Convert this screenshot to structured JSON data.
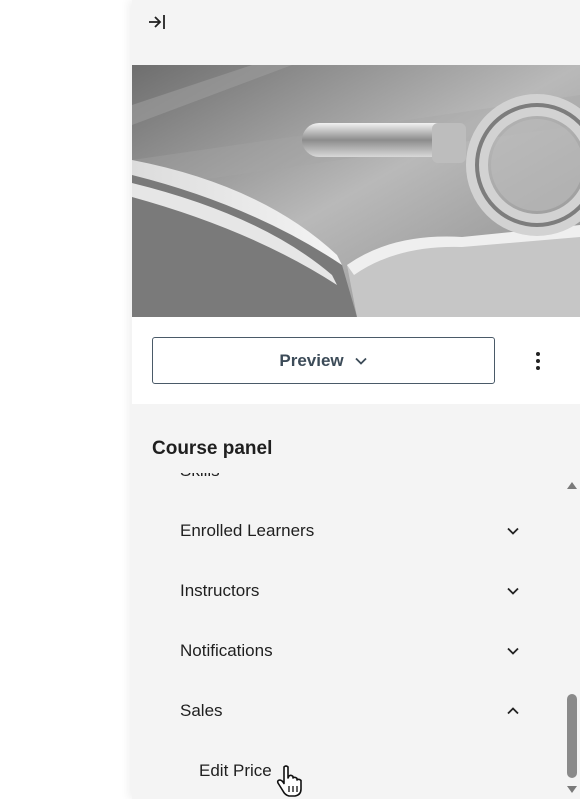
{
  "action_bar": {
    "preview_label": "Preview"
  },
  "course_panel": {
    "title": "Course panel",
    "items": [
      {
        "label": "Skills",
        "icon": "chevron-down-icon"
      },
      {
        "label": "Enrolled Learners",
        "icon": "chevron-down-icon"
      },
      {
        "label": "Instructors",
        "icon": "chevron-down-icon"
      },
      {
        "label": "Notifications",
        "icon": "chevron-down-icon"
      },
      {
        "label": "Sales",
        "icon": "chevron-up-icon",
        "expanded": true
      }
    ],
    "sales_subitems": [
      {
        "label": "Edit Price"
      }
    ]
  },
  "icons": {
    "collapse": "collapse-to-right-icon",
    "more": "vertical-ellipsis-icon",
    "scroll_up": "triangle-up-icon",
    "scroll_down": "triangle-down-icon"
  },
  "colors": {
    "panel_bg": "#f4f4f4",
    "button_border": "#4a5a68",
    "button_text": "#3c4b58",
    "scroll_thumb": "#8a8a8a"
  }
}
